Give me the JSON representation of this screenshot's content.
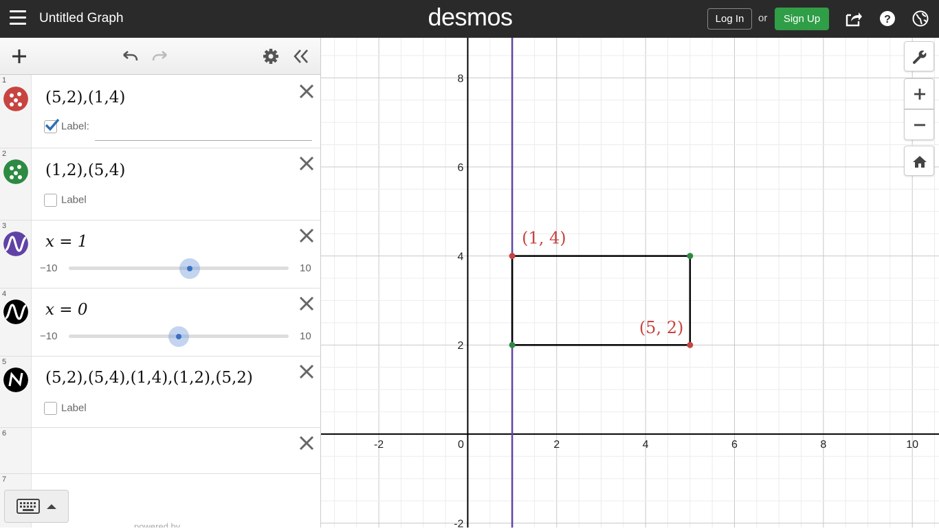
{
  "topbar": {
    "title": "Untitled Graph",
    "logo": "desmos",
    "login_label": "Log In",
    "or_label": "or",
    "signup_label": "Sign Up",
    "icons": [
      "menu-icon",
      "share-icon",
      "help-icon",
      "globe-icon"
    ]
  },
  "toolbar": {
    "icons": [
      "add-icon",
      "undo-icon",
      "redo-icon",
      "settings-icon",
      "collapse-icon"
    ]
  },
  "expressions": [
    {
      "num": "1",
      "latex": "(5,2),(1,4)",
      "label_checked": true,
      "label_text": "Label:",
      "color": "#c74440",
      "icon": "points-icon"
    },
    {
      "num": "2",
      "latex": "(1,2),(5,4)",
      "label_checked": false,
      "label_text": "Label",
      "color": "#2d8a42",
      "icon": "points-icon"
    },
    {
      "num": "3",
      "latex": "x = 1",
      "slider_min": "−10",
      "slider_max": "10",
      "slider_value": 1,
      "color": "#6042a6",
      "icon": "function-icon"
    },
    {
      "num": "4",
      "latex": "x = 0",
      "slider_min": "−10",
      "slider_max": "10",
      "slider_value": 0,
      "color": "#000000",
      "icon": "function-icon"
    },
    {
      "num": "5",
      "latex": "(5,2),(5,4),(1,4),(1,2),(5,2)",
      "label_checked": false,
      "label_text": "Label",
      "color": "#000000",
      "icon": "polyline-icon"
    },
    {
      "num": "6",
      "latex": ""
    },
    {
      "num": "7",
      "latex": ""
    }
  ],
  "footer": {
    "powered_by": "powered by"
  },
  "graph_controls": {
    "icons": [
      "wrench-icon",
      "zoom-in-icon",
      "zoom-out-icon",
      "home-icon"
    ]
  },
  "chart_data": {
    "type": "scatter",
    "xlim": [
      -3.3,
      10.6
    ],
    "ylim": [
      -2.1,
      8.9
    ],
    "grid": true,
    "x_ticks": [
      "-2",
      "0",
      "2",
      "4",
      "6",
      "8",
      "10"
    ],
    "y_ticks": [
      "-2",
      "2",
      "4",
      "6",
      "8"
    ],
    "points_red": [
      [
        5,
        2
      ],
      [
        1,
        4
      ]
    ],
    "points_green": [
      [
        1,
        2
      ],
      [
        5,
        4
      ]
    ],
    "vertical_line_x": 1,
    "polyline": [
      [
        5,
        2
      ],
      [
        5,
        4
      ],
      [
        1,
        4
      ],
      [
        1,
        2
      ],
      [
        5,
        2
      ]
    ],
    "point_labels": [
      {
        "text": "(1, 4)",
        "x": 1,
        "y": 4
      },
      {
        "text": "(5, 2)",
        "x": 5,
        "y": 2
      }
    ],
    "colors": {
      "red": "#c74440",
      "green": "#2d8a42",
      "purple": "#6042a6",
      "black": "#000000"
    }
  }
}
